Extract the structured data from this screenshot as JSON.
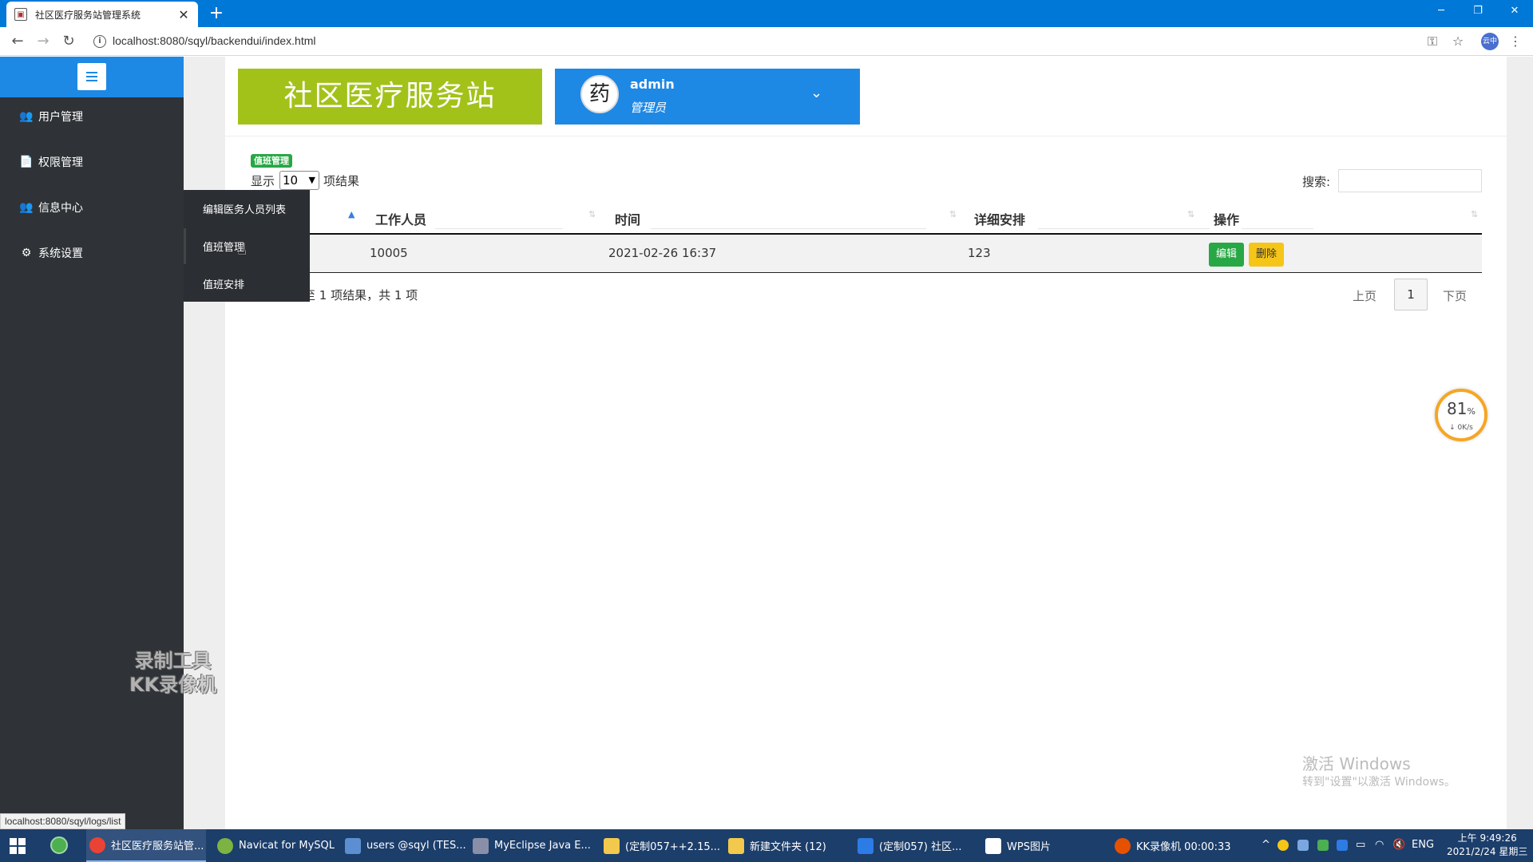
{
  "browser": {
    "tab_title": "社区医疗服务站管理系统",
    "tab_close": "✕",
    "new_tab": "+",
    "url": "localhost:8080/sqyl/backendui/index.html",
    "window_controls": {
      "minimize": "─",
      "maximize": "❐",
      "close": "✕"
    },
    "profile_label": "云中"
  },
  "sidebar": {
    "items": [
      {
        "label": "用户管理",
        "icon": "users-icon",
        "glyph": "👥"
      },
      {
        "label": "权限管理",
        "icon": "file-icon",
        "glyph": "📄"
      },
      {
        "label": "信息中心",
        "icon": "users-icon",
        "glyph": "👥"
      },
      {
        "label": "系统设置",
        "icon": "gears-icon",
        "glyph": "⚙"
      }
    ],
    "submenu": [
      {
        "label": "编辑医务人员列表"
      },
      {
        "label": "值班管理"
      },
      {
        "label": "值班安排"
      }
    ],
    "watermark_line1": "录制工具",
    "watermark_line2": "KK录像机",
    "status_url": "localhost:8080/sqyl/logs/list"
  },
  "header": {
    "brand": "社区医疗服务站",
    "avatar_char": "药",
    "user_name": "admin",
    "user_role": "管理员"
  },
  "page": {
    "badge": "值班管理",
    "length_prefix": "显示",
    "length_value": "10",
    "length_suffix": "项结果",
    "search_label": "搜索:",
    "columns": [
      "工作人员",
      "时间",
      "详细安排",
      "操作"
    ],
    "rows": [
      {
        "staff": "10005",
        "time": "2021-02-26 16:37",
        "detail": "123"
      }
    ],
    "edit_label": "编辑",
    "delete_label": "删除",
    "info": "至 1 项结果，共 1 项",
    "prev": "上页",
    "current_page": "1",
    "next": "下页"
  },
  "speed_widget": {
    "percent": "81",
    "percent_unit": "%",
    "rate": "↓ 0K/s"
  },
  "activation": {
    "line1": "激活 Windows",
    "line2": "转到\"设置\"以激活 Windows。"
  },
  "taskbar": {
    "tasks": [
      {
        "label": "社区医疗服务站管...",
        "color": "#e94335"
      },
      {
        "label": "Navicat for MySQL",
        "color": "#7cb342"
      },
      {
        "label": "users @sqyl (TES...",
        "color": "#5b8fd1"
      },
      {
        "label": "MyEclipse Java E...",
        "color": "#8a8fa8"
      },
      {
        "label": "(定制057++2.15...",
        "color": "#f2c94c"
      },
      {
        "label": "新建文件夹 (12)",
        "color": "#f2c94c"
      },
      {
        "label": "(定制057) 社区...",
        "color": "#2d7be5"
      },
      {
        "label": "WPS图片",
        "color": "#ffffff"
      },
      {
        "label": "KK录像机 00:00:33",
        "color": "#e65100"
      }
    ],
    "tray_text": "^",
    "lang": "ENG",
    "time": "上午 9:49:26",
    "date": "2021/2/24 星期三"
  }
}
